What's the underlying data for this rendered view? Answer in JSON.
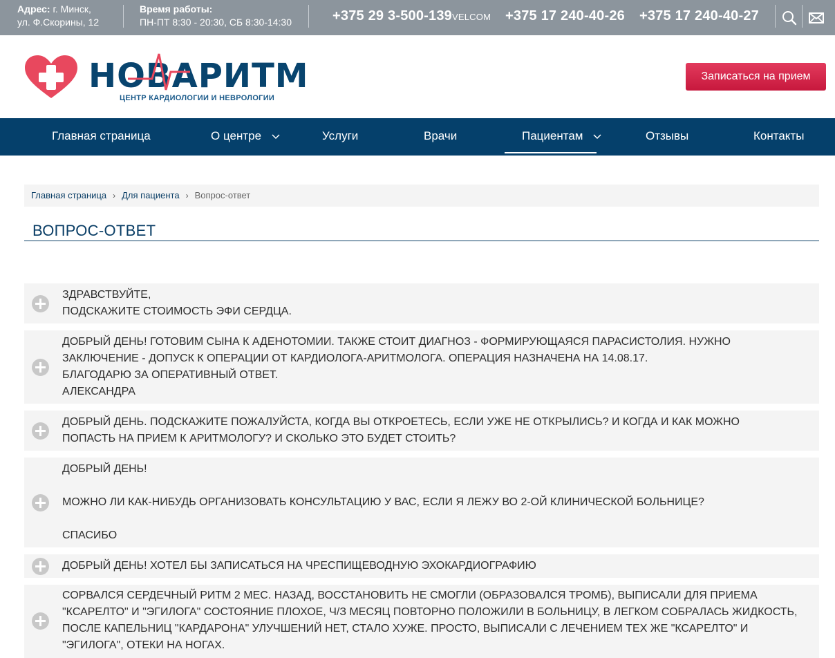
{
  "topbar": {
    "address_label": "Адрес:",
    "address_line1": "г. Минск,",
    "address_line2": "ул. Ф.Скорины, 12",
    "hours_label": "Время работы:",
    "hours_value": "ПН-ПТ 8:30 - 20:30, СБ 8:30-14:30",
    "phone1": "+375 29 3-500-139",
    "phone1_operator": "VELCOM",
    "phone2": "+375 17 240-40-26",
    "phone3": "+375 17 240-40-27",
    "icons": [
      "search-icon",
      "mail-icon"
    ]
  },
  "header": {
    "logo_word": "НОВАРИТМ",
    "logo_sub": "ЦЕНТР КАРДИОЛОГИИ И НЕВРОЛОГИИ",
    "cta_label": "Записаться на прием",
    "cta_color": "#d41f45"
  },
  "nav": {
    "items": [
      {
        "label": "Главная страница"
      },
      {
        "label": "О центре"
      },
      {
        "label": "Услуги"
      },
      {
        "label": "Врачи"
      },
      {
        "label": "Пациентам"
      },
      {
        "label": "Отзывы"
      },
      {
        "label": "Контакты"
      }
    ],
    "active": "Пациентам",
    "color": "#05406b"
  },
  "breadcrumb": {
    "items": [
      "Главная страница",
      "Для пациента"
    ],
    "current": "Вопрос-ответ"
  },
  "page": {
    "title": "ВОПРОС-ОТВЕТ"
  },
  "faq": [
    {
      "question": "ЗДРАВСТВУЙТЕ,\nПОДСКАЖИТЕ СТОИМОСТЬ ЭФИ СЕРДЦА."
    },
    {
      "question": "ДОБРЫЙ ДЕНЬ! ГОТОВИМ СЫНА К АДЕНОТОМИИ. ТАКЖЕ СТОИТ ДИАГНОЗ - ФОРМИРУЮЩАЯСЯ ПАРАСИСТОЛИЯ. НУЖНО ЗАКЛЮЧЕНИЕ - ДОПУСК К ОПЕРАЦИИ ОТ КАРДИОЛОГА-АРИТМОЛОГА. ОПЕРАЦИЯ НАЗНАЧЕНА НА 14.08.17.\nБЛАГОДАРЮ ЗА ОПЕРАТИВНЫЙ ОТВЕТ.\nАЛЕКСАНДРА"
    },
    {
      "question": "ДОБРЫЙ ДЕНЬ. ПОДСКАЖИТЕ ПОЖАЛУЙСТА, КОГДА ВЫ ОТКРОЕТЕСЬ, ЕСЛИ УЖЕ НЕ ОТКРЫЛИСЬ? И КОГДА И КАК МОЖНО ПОПАСТЬ НА ПРИЕМ К АРИТМОЛОГУ? И СКОЛЬКО ЭТО БУДЕТ СТОИТЬ?"
    },
    {
      "question": "ДОБРЫЙ ДЕНЬ!\n\nМОЖНО ЛИ КАК-НИБУДЬ ОРГАНИЗОВАТЬ КОНСУЛЬТАЦИЮ У ВАС, ЕСЛИ Я ЛЕЖУ ВО 2-ОЙ КЛИНИЧЕСКОЙ БОЛЬНИЦЕ?\n\nСПАСИБО"
    },
    {
      "question": "ДОБРЫЙ ДЕНЬ! ХОТЕЛ БЫ ЗАПИСАТЬСЯ НА ЧРЕСПИЩЕВОДНУЮ ЭХОКАРДИОГРАФИЮ"
    },
    {
      "question": "СОРВАЛСЯ СЕРДЕЧНЫЙ РИТМ 2 МЕС. НАЗАД, ВОССТАНОВИТЬ НЕ СМОГЛИ (ОБРАЗОВАЛСЯ ТРОМБ), ВЫПИСАЛИ ДЛЯ ПРИЕМА \"КСАРЕЛТО\" И \"ЭГИЛОГА\" СОСТОЯНИЕ ПЛОХОЕ, Ч/З МЕСЯЦ ПОВТОРНО ПОЛОЖИЛИ В БОЛЬНИЦУ, В ЛЕГКОМ СОБРАЛАСЬ ЖИДКОСТЬ, ПОСЛЕ КАПЕЛЬНИЦ \"КАРДАРОНА\" УЛУЧШЕНИЙ НЕТ, СТАЛО ХУЖЕ. ПРОСТО, ВЫПИСАЛИ С ЛЕЧЕНИЕМ ТЕХ ЖЕ \"КСАРЕЛТО\" И \"ЭГИЛОГА\", ОТЕКИ НА НОГАХ."
    }
  ]
}
